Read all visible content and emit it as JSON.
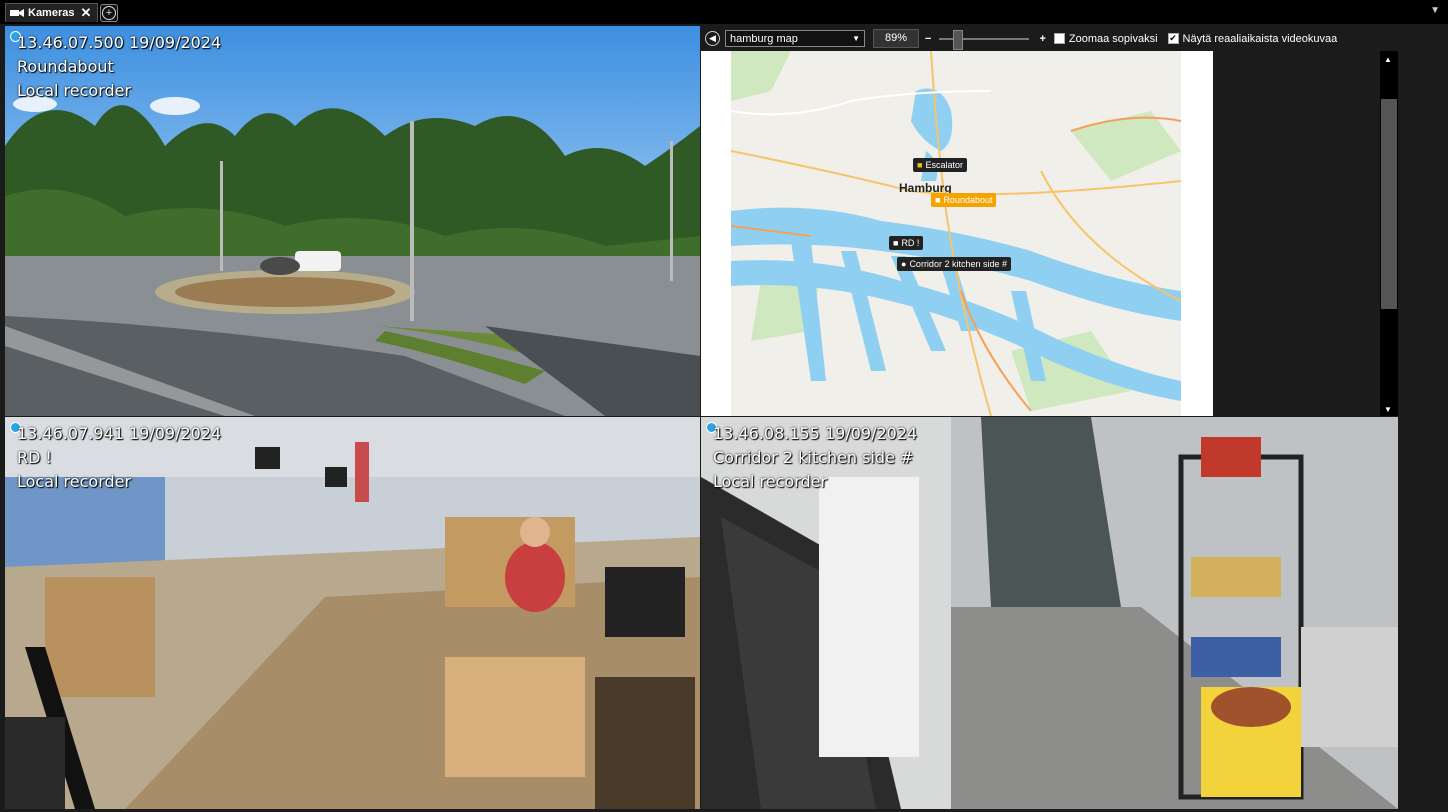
{
  "tabs": {
    "camera_tab_label": "Kameras",
    "close_glyph": "✕",
    "add_glyph": "+"
  },
  "cameras": [
    {
      "timestamp": "13.46.07.500  19/09/2024",
      "name": "Roundabout",
      "source": "Local recorder"
    },
    {
      "timestamp": "13.46.07.941  19/09/2024",
      "name": "RD !",
      "source": "Local recorder"
    },
    {
      "timestamp": "13.46.08.155  19/09/2024",
      "name": "Corridor 2 kitchen side #",
      "source": "Local recorder"
    }
  ],
  "map": {
    "selected_map": "hamburg map",
    "zoom": "89%",
    "zoom_level_fraction": 0.18,
    "fit_label": "Zoomaa sopivaksi",
    "fit_checked": false,
    "live_label": "Näytä reaaliaikaista videokuvaa",
    "live_checked": true,
    "city_label": "Hamburg",
    "markers": [
      "Escalator",
      "Roundabout",
      "RD !",
      "Corridor 2 kitchen side #"
    ],
    "selected_marker": "Roundabout"
  },
  "colors": {
    "accent": "#f5a300",
    "status_dot": "#2aa3e8",
    "water": "#8fd0f2"
  }
}
